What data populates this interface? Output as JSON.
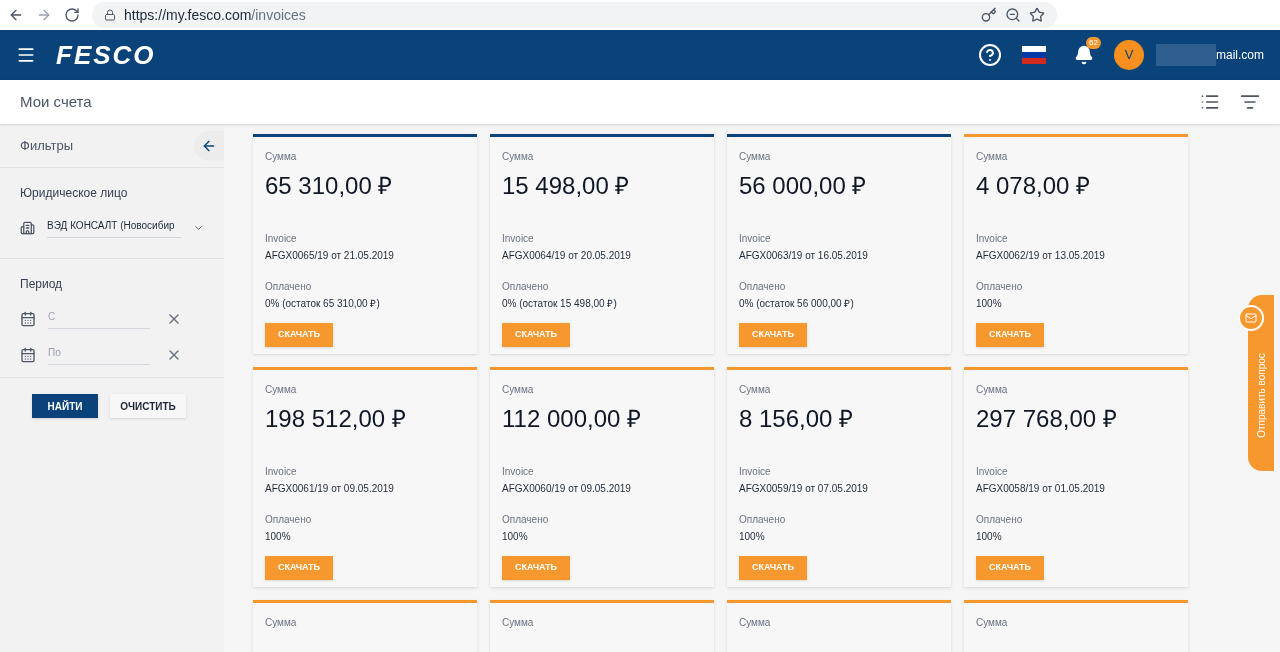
{
  "browser": {
    "url_host": "https://my.fesco.com",
    "url_path": "/invoices"
  },
  "header": {
    "logo": "FESCO",
    "notifications": "62",
    "avatar": "V",
    "email": "mail.com"
  },
  "page_title": "Мои счета",
  "filters": {
    "title": "Фильтры",
    "legal_entity_label": "Юридическое лицо",
    "legal_entity_value": "ВЭД КОНСАЛТ (Новосибир",
    "period_label": "Период",
    "from_placeholder": "С",
    "to_placeholder": "По",
    "find_button": "НАЙТИ",
    "clear_button": "ОЧИСТИТЬ"
  },
  "feedback": {
    "label": "Отправить вопрос"
  },
  "invoices": [
    {
      "sum_label": "Сумма",
      "amount": "65 310,00 ₽",
      "invoice_label": "Invoice",
      "invoice": "AFGX0065/19 от 21.05.2019",
      "paid_label": "Оплачено",
      "paid": "0% (остаток 65 310,00 ₽)",
      "button": "СКАЧАТЬ",
      "color": "#0a4379"
    },
    {
      "sum_label": "Сумма",
      "amount": "15 498,00 ₽",
      "invoice_label": "Invoice",
      "invoice": "AFGX0064/19 от 20.05.2019",
      "paid_label": "Оплачено",
      "paid": "0% (остаток 15 498,00 ₽)",
      "button": "СКАЧАТЬ",
      "color": "#0a4379"
    },
    {
      "sum_label": "Сумма",
      "amount": "56 000,00 ₽",
      "invoice_label": "Invoice",
      "invoice": "AFGX0063/19 от 16.05.2019",
      "paid_label": "Оплачено",
      "paid": "0% (остаток 56 000,00 ₽)",
      "button": "СКАЧАТЬ",
      "color": "#0a4379"
    },
    {
      "sum_label": "Сумма",
      "amount": "4 078,00 ₽",
      "invoice_label": "Invoice",
      "invoice": "AFGX0062/19 от 13.05.2019",
      "paid_label": "Оплачено",
      "paid": "100%",
      "button": "СКАЧАТЬ",
      "color": "#f7982f"
    },
    {
      "sum_label": "Сумма",
      "amount": "198 512,00 ₽",
      "invoice_label": "Invoice",
      "invoice": "AFGX0061/19 от 09.05.2019",
      "paid_label": "Оплачено",
      "paid": "100%",
      "button": "СКАЧАТЬ",
      "color": "#f7982f"
    },
    {
      "sum_label": "Сумма",
      "amount": "112 000,00 ₽",
      "invoice_label": "Invoice",
      "invoice": "AFGX0060/19 от 09.05.2019",
      "paid_label": "Оплачено",
      "paid": "100%",
      "button": "СКАЧАТЬ",
      "color": "#f7982f"
    },
    {
      "sum_label": "Сумма",
      "amount": "8 156,00 ₽",
      "invoice_label": "Invoice",
      "invoice": "AFGX0059/19 от 07.05.2019",
      "paid_label": "Оплачено",
      "paid": "100%",
      "button": "СКАЧАТЬ",
      "color": "#f7982f"
    },
    {
      "sum_label": "Сумма",
      "amount": "297 768,00 ₽",
      "invoice_label": "Invoice",
      "invoice": "AFGX0058/19 от 01.05.2019",
      "paid_label": "Оплачено",
      "paid": "100%",
      "button": "СКАЧАТЬ",
      "color": "#f7982f"
    },
    {
      "sum_label": "Сумма",
      "color": "#f7982f"
    },
    {
      "sum_label": "Сумма",
      "color": "#f7982f"
    },
    {
      "sum_label": "Сумма",
      "color": "#f7982f"
    },
    {
      "sum_label": "Сумма",
      "color": "#f7982f"
    }
  ]
}
